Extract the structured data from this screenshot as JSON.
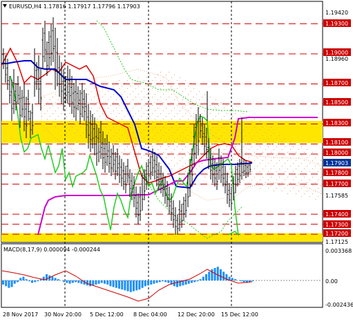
{
  "header": {
    "symbol": "EURUSD,H4",
    "open": "1.17816",
    "high": "1.17917",
    "low": "1.17796",
    "close": "1.17903"
  },
  "colors": {
    "resistance_line": "#cc0000",
    "support_zone": "#ffe600",
    "price_line": "#000000",
    "ma_red": "#dd0000",
    "ma_blue": "#0000cc",
    "ma_magenta": "#cc00cc",
    "chikou_green": "#22cc22",
    "cloud_dots": "#e8a070",
    "macd_bar": "#1e90ff",
    "macd_signal": "#cc0000",
    "current_price_tag": "#003399"
  },
  "price_axis": {
    "labels": [
      {
        "text": "1.19420",
        "plain": true
      },
      {
        "text": "1.19300",
        "plain": false
      },
      {
        "text": "1.19000",
        "plain": false
      },
      {
        "text": "1.18960",
        "plain": true
      },
      {
        "text": "1.18700",
        "plain": false
      },
      {
        "text": "1.18500",
        "plain": false
      },
      {
        "text": "1.18300",
        "plain": false
      },
      {
        "text": "1.18100",
        "plain": false
      },
      {
        "text": "1.18000",
        "plain": false
      },
      {
        "text": "1.17903",
        "plain": false,
        "current": true
      },
      {
        "text": "1.17800",
        "plain": false
      },
      {
        "text": "1.17700",
        "plain": false
      },
      {
        "text": "1.17585",
        "plain": true
      },
      {
        "text": "1.17400",
        "plain": false
      },
      {
        "text": "1.17300",
        "plain": false
      },
      {
        "text": "1.17200",
        "plain": false
      },
      {
        "text": "1.17125",
        "plain": true
      }
    ]
  },
  "macd": {
    "label": "MACD(8,17,9) 0.000094 -0.000244",
    "axis_labels": [
      "0.003368",
      "0.00",
      "-0.002436"
    ]
  },
  "time_axis": {
    "labels": [
      "28 Nov 2017",
      "30 Nov 20:00",
      "5 Dec 12:00",
      "8 Dec 04:00",
      "12 Dec 20:00",
      "15 Dec 12:00"
    ]
  }
}
